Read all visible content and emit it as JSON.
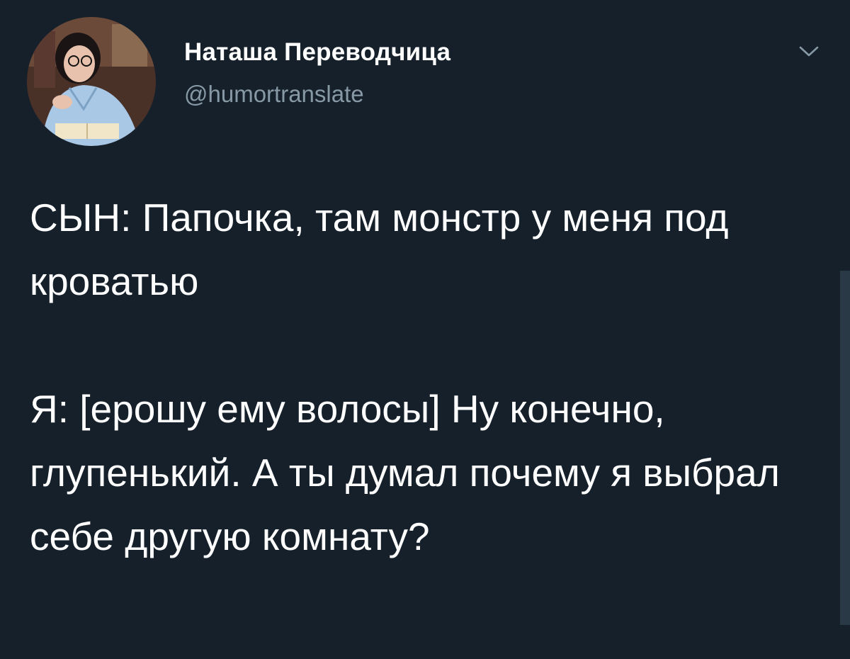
{
  "tweet": {
    "author": {
      "display_name": "Наташа Переводчица",
      "handle": "@humortranslate",
      "avatar": "avatar-photo"
    },
    "menu_icon": "chevron-down-icon",
    "text": "СЫН: Папочка, там монстр у меня под кроватью\n\nЯ: [ерошу ему волосы] Ну конечно, глупенький. А ты думал почему я выбрал себе другую комнату?"
  },
  "colors": {
    "background": "#15202b",
    "primary_text": "#ffffff",
    "secondary_text": "#8899a6"
  }
}
